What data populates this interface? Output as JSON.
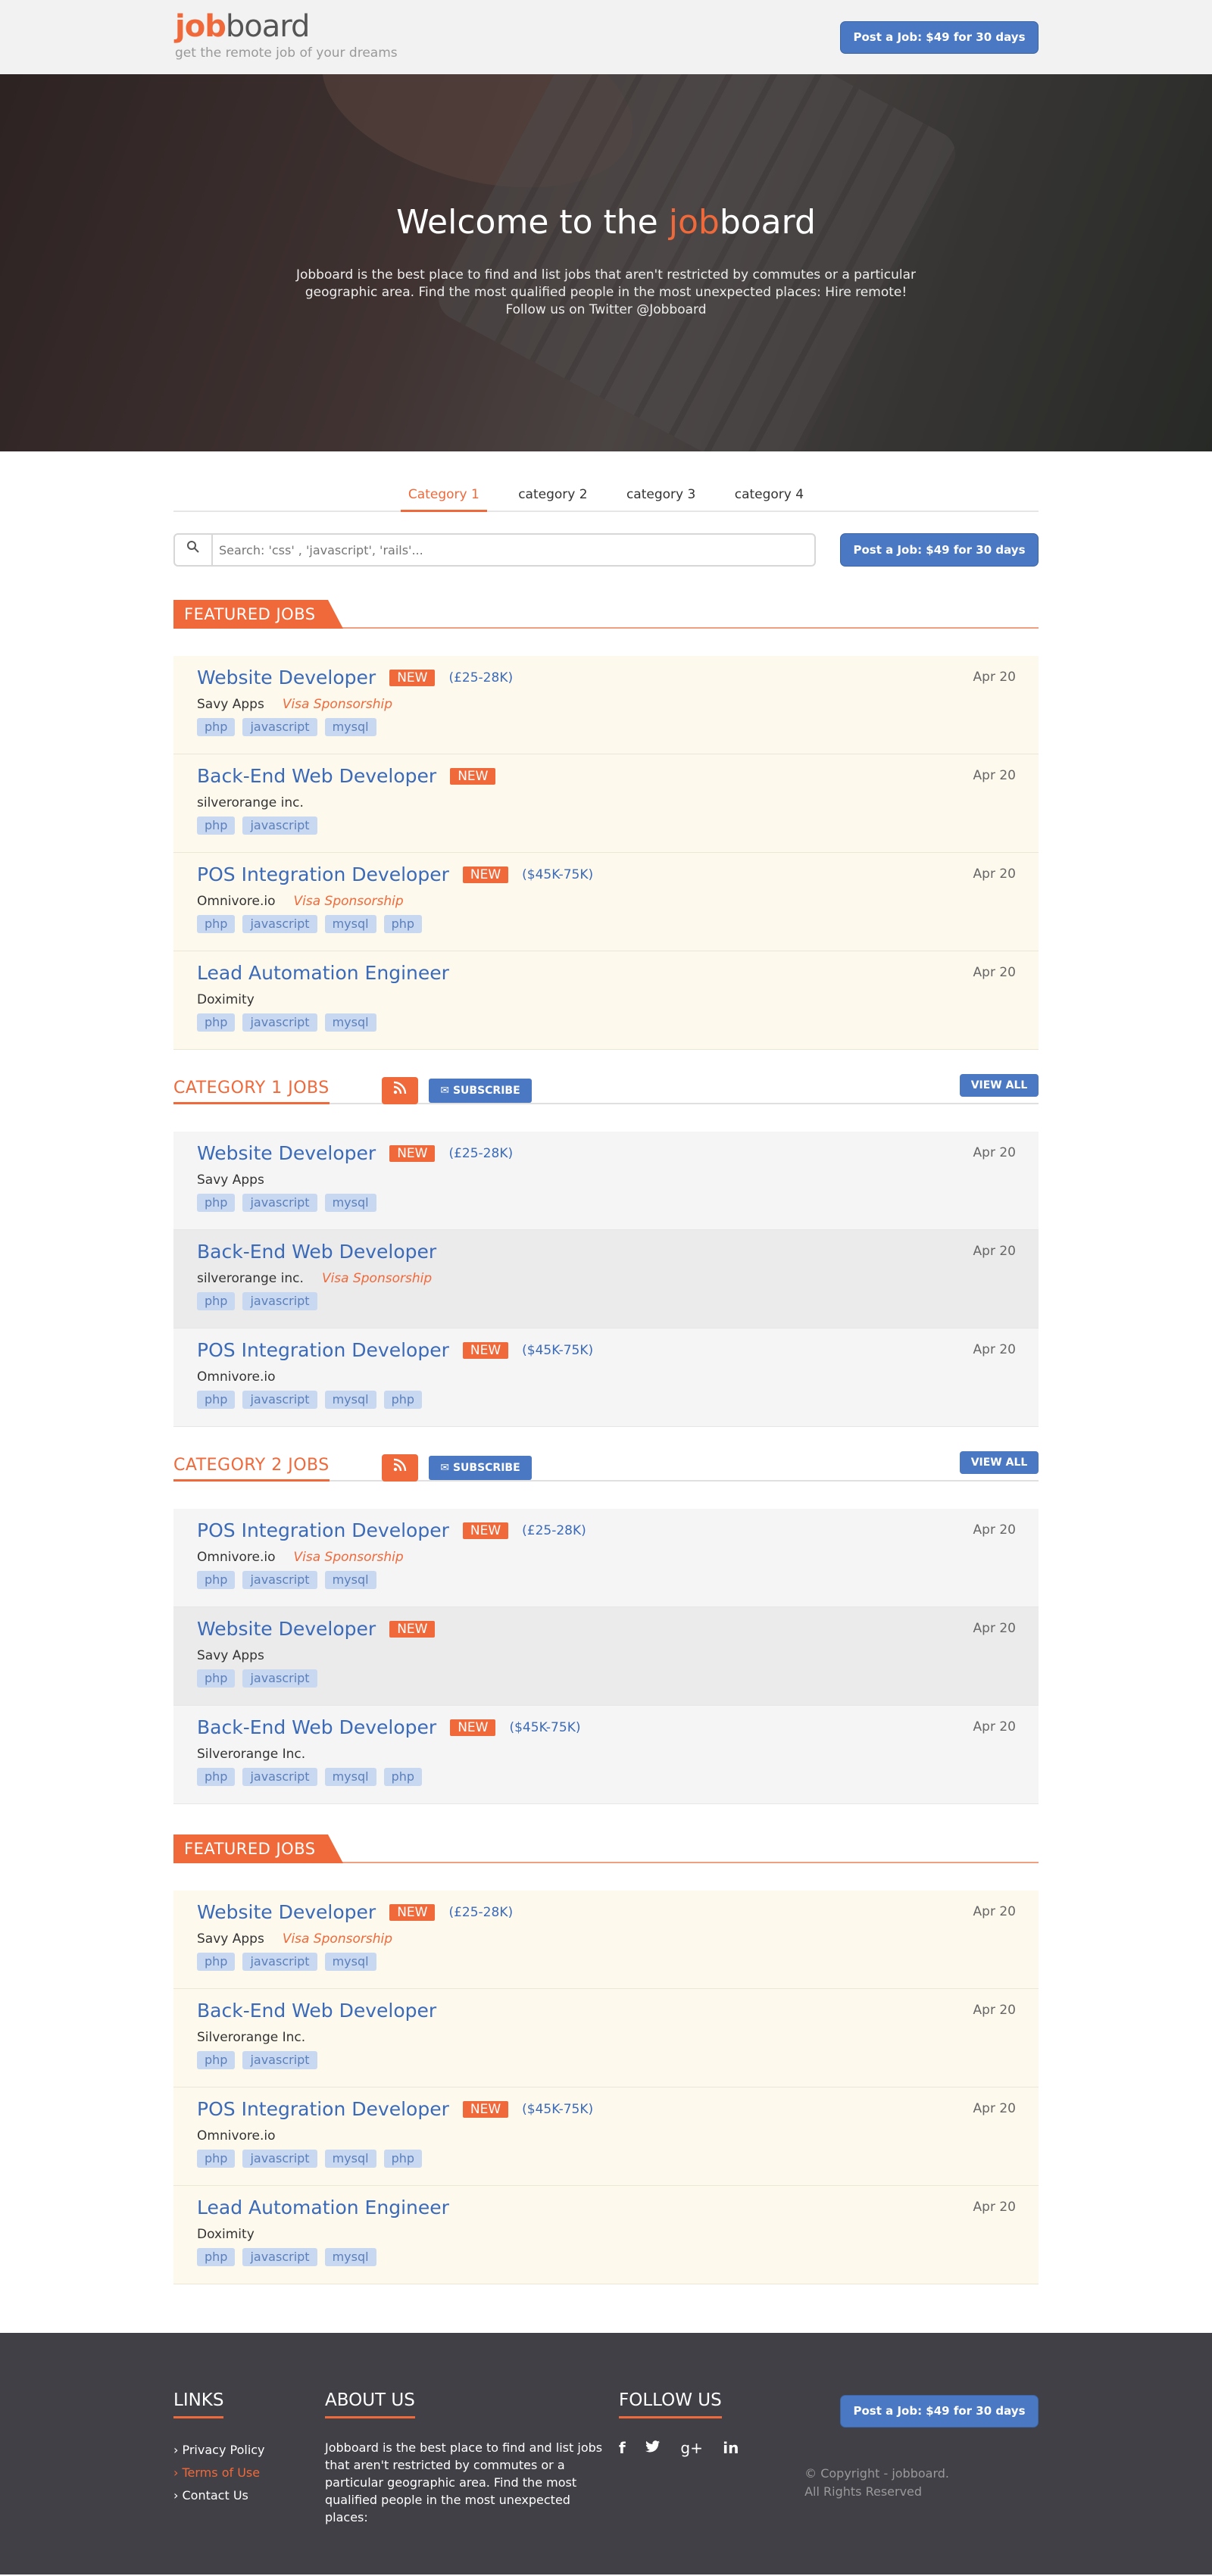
{
  "header": {
    "logo_bold": "job",
    "logo_rest": "board",
    "tagline": "get the remote job of your dreams",
    "post_button": "Post a Job: $49 for 30 days"
  },
  "hero": {
    "title_pre": "Welcome to the ",
    "title_bold": "job",
    "title_post": "board",
    "text": "Jobboard is the best place to find and list jobs that aren't restricted by commutes or a particular geographic area. Find the most qualified people in the most unexpected places: Hire remote! Follow us on Twitter @Jobboard"
  },
  "tabs": [
    "Category 1",
    "category 2",
    "category 3",
    "category 4"
  ],
  "search": {
    "placeholder": "Search: 'css' , 'javascript', 'rails'...",
    "post_button": "Post a Job: $49 for 30 days"
  },
  "featured1": {
    "label": "FEATURED JOBS",
    "jobs": [
      {
        "title": "Website Developer",
        "badge": "NEW",
        "salary": "(£25-28K)",
        "company": "Savy Apps",
        "visa": "Visa Sponsorship",
        "tags": [
          "php",
          "javascript",
          "mysql"
        ],
        "date": "Apr 20"
      },
      {
        "title": "Back-End Web Developer",
        "badge": "NEW",
        "salary": "",
        "company": "silverorange inc.",
        "visa": "",
        "tags": [
          "php",
          "javascript"
        ],
        "date": "Apr 20"
      },
      {
        "title": "POS Integration Developer",
        "badge": "NEW",
        "salary": "($45K-75K)",
        "company": "Omnivore.io",
        "visa": "Visa Sponsorship",
        "tags": [
          "php",
          "javascript",
          "mysql",
          "php"
        ],
        "date": "Apr 20"
      },
      {
        "title": "Lead Automation Engineer",
        "badge": "",
        "salary": "",
        "company": "Doximity",
        "visa": "",
        "tags": [
          "php",
          "javascript",
          "mysql"
        ],
        "date": "Apr 20"
      }
    ]
  },
  "category1": {
    "label": "CATEGORY 1 JOBS",
    "subscribe": "SUBSCRIBE",
    "view_all": "VIEW ALL",
    "jobs": [
      {
        "title": "Website Developer",
        "badge": "NEW",
        "salary": "(£25-28K)",
        "company": "Savy Apps",
        "visa": "",
        "tags": [
          "php",
          "javascript",
          "mysql"
        ],
        "date": "Apr 20"
      },
      {
        "title": "Back-End Web Developer",
        "badge": "",
        "salary": "",
        "company": "silverorange inc.",
        "visa": "Visa Sponsorship",
        "tags": [
          "php",
          "javascript"
        ],
        "date": "Apr 20"
      },
      {
        "title": "POS Integration Developer",
        "badge": "NEW",
        "salary": "($45K-75K)",
        "company": "Omnivore.io",
        "visa": "",
        "tags": [
          "php",
          "javascript",
          "mysql",
          "php"
        ],
        "date": "Apr 20"
      }
    ]
  },
  "category2": {
    "label": "CATEGORY 2 JOBS",
    "subscribe": "SUBSCRIBE",
    "view_all": "VIEW ALL",
    "jobs": [
      {
        "title": "POS Integration Developer",
        "badge": "NEW",
        "salary": "(£25-28K)",
        "company": "Omnivore.io",
        "visa": "Visa Sponsorship",
        "tags": [
          "php",
          "javascript",
          "mysql"
        ],
        "date": "Apr 20"
      },
      {
        "title": "Website Developer",
        "badge": "NEW",
        "salary": "",
        "company": "Savy Apps",
        "visa": "",
        "tags": [
          "php",
          "javascript"
        ],
        "date": "Apr 20"
      },
      {
        "title": "Back-End Web Developer",
        "badge": "NEW",
        "salary": "($45K-75K)",
        "company": "Silverorange Inc.",
        "visa": "",
        "tags": [
          "php",
          "javascript",
          "mysql",
          "php"
        ],
        "date": "Apr 20"
      }
    ]
  },
  "featured2": {
    "label": "FEATURED JOBS",
    "jobs": [
      {
        "title": "Website Developer",
        "badge": "NEW",
        "salary": "(£25-28K)",
        "company": "Savy Apps",
        "visa": "Visa Sponsorship",
        "tags": [
          "php",
          "javascript",
          "mysql"
        ],
        "date": "Apr 20"
      },
      {
        "title": "Back-End Web Developer",
        "badge": "",
        "salary": "",
        "company": "Silverorange Inc.",
        "visa": "",
        "tags": [
          "php",
          "javascript"
        ],
        "date": "Apr 20"
      },
      {
        "title": "POS Integration Developer",
        "badge": "NEW",
        "salary": "($45K-75K)",
        "company": "Omnivore.io",
        "visa": "",
        "tags": [
          "php",
          "javascript",
          "mysql",
          "php"
        ],
        "date": "Apr 20"
      },
      {
        "title": "Lead Automation Engineer",
        "badge": "",
        "salary": "",
        "company": "Doximity",
        "visa": "",
        "tags": [
          "php",
          "javascript",
          "mysql"
        ],
        "date": "Apr 20"
      }
    ]
  },
  "footer": {
    "links_title": "LINKS",
    "links": [
      "Privacy Policy",
      "Terms of Use",
      "Contact Us"
    ],
    "about_title": "ABOUT US",
    "about_text": "Jobboard is the best place to find and list jobs that aren't restricted by commutes or a particular geographic area. Find the most qualified people in the most unexpected places:",
    "follow_title": "FOLLOW US",
    "social": [
      "facebook-icon",
      "twitter-icon",
      "google-plus-icon",
      "linkedin-icon"
    ],
    "post_button": "Post a Job: $49 for 30 days",
    "copyright": "© Copyright - jobboard.",
    "rights": "All Rights Reserved"
  },
  "colors": {
    "accent": "#f0693a",
    "blue": "#4a78c2",
    "footer_bg": "#404046",
    "featured_bg": "#fdf9ed"
  }
}
